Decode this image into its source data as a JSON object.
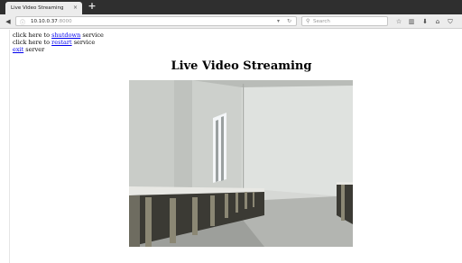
{
  "browser": {
    "tab_title": "Live Video Streaming",
    "tab_close": "×",
    "new_tab": "+",
    "url_host": "10.10.0.37",
    "url_port": ":8000",
    "search_placeholder": "Search"
  },
  "page": {
    "line1_prefix": "click here to",
    "line1_link": "shutdown",
    "line1_suffix": "service",
    "line2_prefix": "click here to",
    "line2_link": "restart",
    "line2_suffix": "service",
    "line3_link": "exit",
    "line3_suffix": "server",
    "title": "Live Video Streaming"
  },
  "icons": {
    "back": "back-arrow-icon",
    "info": "info-icon",
    "reload": "reload-icon",
    "search": "search-icon",
    "bookmark_star": "star-icon",
    "library": "library-icon",
    "downloads": "download-icon",
    "home": "home-icon",
    "pocket": "pocket-icon"
  },
  "colors": {
    "tabbar": "#2f2f2f",
    "link": "#0000ee"
  }
}
